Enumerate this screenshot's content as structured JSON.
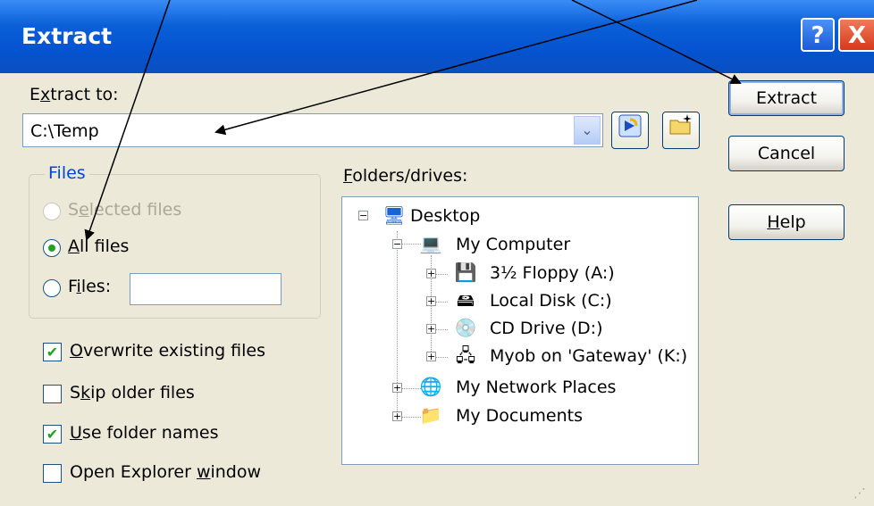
{
  "window": {
    "title": "Extract"
  },
  "title_buttons": {
    "help": "?",
    "close": "X"
  },
  "extract_to": {
    "label_pre": "E",
    "label_mnemonic": "x",
    "label_post": "tract to:",
    "value": "C:\\Temp"
  },
  "files_group": {
    "legend": "Files",
    "selected": {
      "pre": "S",
      "mn": "e",
      "post": "lected files",
      "disabled": true
    },
    "all": {
      "mn": "A",
      "post": "ll files",
      "checked": true
    },
    "files": {
      "pre": "F",
      "mn": "i",
      "post": "les:"
    }
  },
  "options": {
    "overwrite": {
      "mn": "O",
      "post": "verwrite existing files",
      "checked": true
    },
    "skip": {
      "pre": "S",
      "mn": "k",
      "post": "ip older files",
      "checked": false
    },
    "folder_names": {
      "mn": "U",
      "post": "se folder names",
      "checked": true
    },
    "explorer": {
      "pre": "Open Explorer ",
      "mn": "w",
      "post": "indow",
      "checked": false
    }
  },
  "folders": {
    "label_mn": "F",
    "label_post": "olders/drives:",
    "tree": [
      {
        "label": "Desktop",
        "icon": "desktop-icon"
      },
      {
        "label": "My Computer",
        "icon": "computer-icon"
      },
      {
        "label": "3½ Floppy (A:)",
        "icon": "floppy-icon"
      },
      {
        "label": "Local Disk (C:)",
        "icon": "disk-icon"
      },
      {
        "label": "CD Drive (D:)",
        "icon": "cd-icon"
      },
      {
        "label": "Myob on 'Gateway' (K:)",
        "icon": "network-drive-icon"
      },
      {
        "label": "My Network Places",
        "icon": "network-icon"
      },
      {
        "label": "My Documents",
        "icon": "documents-icon"
      }
    ]
  },
  "buttons": {
    "extract": "Extract",
    "cancel": "Cancel",
    "help_mn": "H",
    "help_post": "elp"
  },
  "glyphs": {
    "check": "✔",
    "plus": "+",
    "minus": "−",
    "drop": "⌄",
    "grip": "⋰"
  }
}
